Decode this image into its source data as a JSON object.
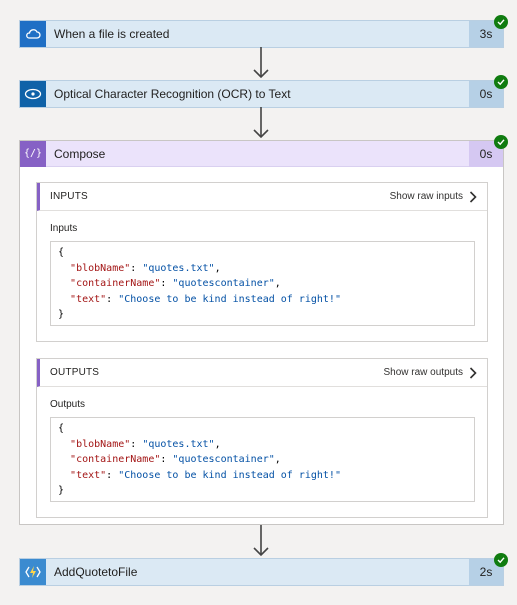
{
  "steps": {
    "trigger": {
      "title": "When a file is created",
      "duration": "3s",
      "color": "#1f6fc5",
      "icon": "cloud-icon"
    },
    "ocr": {
      "title": "Optical Character Recognition (OCR) to Text",
      "duration": "0s",
      "color": "#0f62a8",
      "icon": "eye-icon"
    },
    "compose": {
      "title": "Compose",
      "duration": "0s",
      "color": "#8661c5",
      "icon": "compose-icon",
      "icon_text": "{/}"
    },
    "addquote": {
      "title": "AddQuotetoFile",
      "duration": "2s",
      "color": "#3b8bd0",
      "icon": "function-icon"
    }
  },
  "inputs": {
    "header": "INPUTS",
    "raw_link": "Show raw inputs",
    "label": "Inputs",
    "json": {
      "open": "{",
      "close": "}",
      "k1": "\"blobName\"",
      "v1": "\"quotes.txt\"",
      "k2": "\"containerName\"",
      "v2": "\"quotescontainer\"",
      "k3": "\"text\"",
      "v3": "\"Choose to be kind instead of right!\""
    }
  },
  "outputs": {
    "header": "OUTPUTS",
    "raw_link": "Show raw outputs",
    "label": "Outputs",
    "json": {
      "open": "{",
      "close": "}",
      "k1": "\"blobName\"",
      "v1": "\"quotes.txt\"",
      "k2": "\"containerName\"",
      "v2": "\"quotescontainer\"",
      "k3": "\"text\"",
      "v3": "\"Choose to be kind instead of right!\""
    }
  },
  "colors": {
    "success": "#107c10",
    "accent_purple": "#8661c5",
    "step_bg": "#dbe9f4"
  }
}
